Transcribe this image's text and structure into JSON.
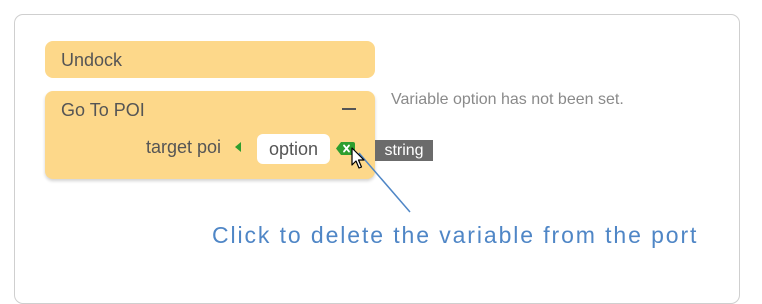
{
  "blocks": {
    "undock": {
      "title": "Undock"
    },
    "go_to_poi": {
      "title": "Go To POI",
      "collapse_symbol": "−",
      "port_label": "target poi",
      "port_value": "option",
      "delete_icon": "delete-variable-icon",
      "delete_symbol": "×"
    }
  },
  "type_badge": "string",
  "warning": "Variable option has not been set.",
  "annotation": "Click to delete the variable from the port",
  "colors": {
    "block": "#fdd88a",
    "delete": "#2e9e2e",
    "annotation": "#4f86c6",
    "badge": "#6b6b6b"
  }
}
